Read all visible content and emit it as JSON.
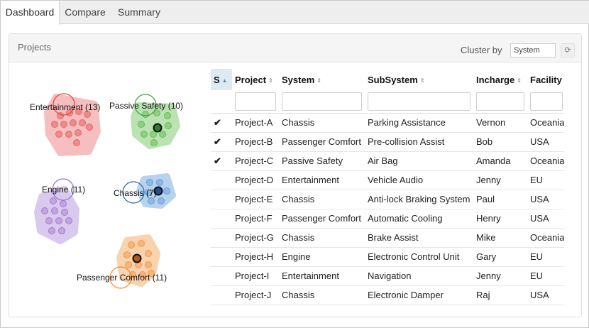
{
  "tabs": [
    {
      "label": "Dashboard",
      "active": true
    },
    {
      "label": "Compare",
      "active": false
    },
    {
      "label": "Summary",
      "active": false
    }
  ],
  "panel": {
    "title": "Projects",
    "cluster_by_label": "Cluster by",
    "cluster_by_value": "System",
    "refresh_icon": "refresh-icon"
  },
  "clusters": [
    {
      "label": "Entertainment (13)",
      "count": 13,
      "color": "#f08080",
      "fill": "#f4a6a6",
      "highlighted_members": 0
    },
    {
      "label": "Passive Safety (10)",
      "count": 10,
      "color": "#66bb66",
      "fill": "#a8dca0",
      "highlighted_members": 1
    },
    {
      "label": "Engine (11)",
      "count": 11,
      "color": "#b591d8",
      "fill": "#d2bde8",
      "highlighted_members": 0
    },
    {
      "label": "Chassis (7)",
      "count": 7,
      "color": "#6fa3d6",
      "fill": "#a9c9e8",
      "highlighted_members": 1
    },
    {
      "label": "Passenger Comfort (11)",
      "count": 11,
      "color": "#f5a35a",
      "fill": "#f8c79a",
      "highlighted_members": 1
    }
  ],
  "table": {
    "columns": [
      {
        "label": "S",
        "sorted": true
      },
      {
        "label": "Project",
        "sorted": false
      },
      {
        "label": "System",
        "sorted": false
      },
      {
        "label": "SubSystem",
        "sorted": false
      },
      {
        "label": "Incharge",
        "sorted": false
      },
      {
        "label": "Facility",
        "sorted": false
      }
    ],
    "rows": [
      {
        "selected": true,
        "check": "✔",
        "project": "Project-A",
        "system": "Chassis",
        "subsystem": "Parking Assistance",
        "incharge": "Vernon",
        "facility": "Oceania"
      },
      {
        "selected": true,
        "check": "✔",
        "project": "Project-B",
        "system": "Passenger Comfort",
        "subsystem": "Pre-collision Assist",
        "incharge": "Bob",
        "facility": "USA"
      },
      {
        "selected": true,
        "check": "✔",
        "project": "Project-C",
        "system": "Passive Safety",
        "subsystem": "Air Bag",
        "incharge": "Amanda",
        "facility": "Oceania"
      },
      {
        "selected": false,
        "check": "",
        "project": "Project-D",
        "system": "Entertainment",
        "subsystem": "Vehicle Audio",
        "incharge": "Jenny",
        "facility": "EU"
      },
      {
        "selected": false,
        "check": "",
        "project": "Project-E",
        "system": "Chassis",
        "subsystem": "Anti-lock Braking System",
        "incharge": "Paul",
        "facility": "USA"
      },
      {
        "selected": false,
        "check": "",
        "project": "Project-F",
        "system": "Passenger Comfort",
        "subsystem": "Automatic Cooling",
        "incharge": "Henry",
        "facility": "USA"
      },
      {
        "selected": false,
        "check": "",
        "project": "Project-G",
        "system": "Chassis",
        "subsystem": "Brake Assist",
        "incharge": "Mike",
        "facility": "Oceania"
      },
      {
        "selected": false,
        "check": "",
        "project": "Project-H",
        "system": "Engine",
        "subsystem": "Electronic Control Unit",
        "incharge": "Gary",
        "facility": "EU"
      },
      {
        "selected": false,
        "check": "",
        "project": "Project-I",
        "system": "Entertainment",
        "subsystem": "Navigation",
        "incharge": "Jenny",
        "facility": "EU"
      },
      {
        "selected": false,
        "check": "",
        "project": "Project-J",
        "system": "Chassis",
        "subsystem": "Electronic Damper",
        "incharge": "Raj",
        "facility": "USA"
      }
    ]
  }
}
